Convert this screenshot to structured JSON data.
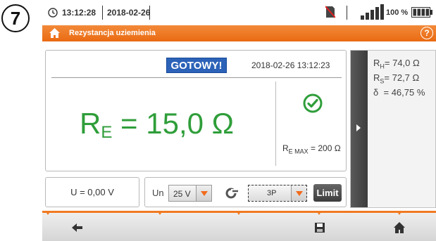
{
  "step_number": "7",
  "status_bar": {
    "time": "13:12:28",
    "date": "2018-02-26",
    "battery_percent": "100 %",
    "icons": [
      "clock-icon",
      "no-memory-card-icon",
      "signal-strength-icon",
      "battery-icon"
    ]
  },
  "title_bar": {
    "title": "Rezystancja uziemienia",
    "help_label": "?"
  },
  "main": {
    "status_badge": "GOTOWY!",
    "datetime": "2018-02-26 13:12:23",
    "result_symbol": "R",
    "result_sub": "E",
    "result_value": "= 15,0 Ω",
    "limit_symbol": "R",
    "limit_sub": "E MAX",
    "limit_value": "= 200 Ω",
    "status_icon": "check-circle-icon"
  },
  "side_panel": {
    "rows": [
      {
        "symbol": "R",
        "sub": "H",
        "value": "= 74,0 Ω"
      },
      {
        "symbol": "R",
        "sub": "S",
        "value": "= 72,7 Ω"
      },
      {
        "symbol": "δ",
        "sub": "",
        "value": "= 46,75 %"
      }
    ]
  },
  "controls": {
    "voltage": "U = 0,00 V",
    "un_label": "Un",
    "un_value": "25 V",
    "mode_value": "3P",
    "limit_label": "Limit"
  },
  "colors": {
    "accent": "#ea6a12",
    "result_green": "#2f9e3a",
    "badge_blue": "#2c62b8"
  }
}
